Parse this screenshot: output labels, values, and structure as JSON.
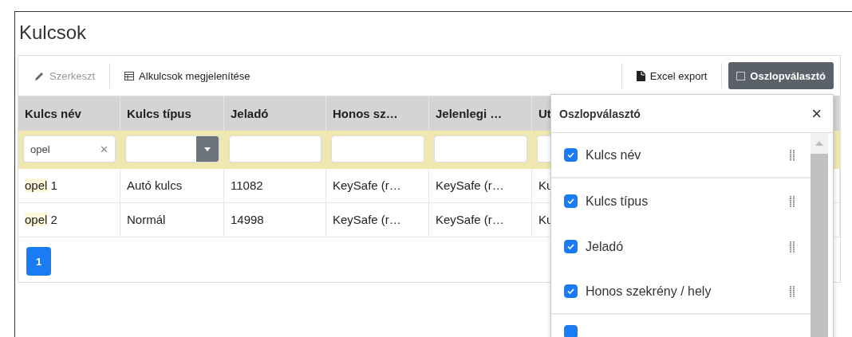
{
  "title": "Kulcsok",
  "toolbar": {
    "left": [
      {
        "label": "Szerkeszt",
        "disabled": true
      },
      {
        "label": "Alkulcsok megjelenítése",
        "disabled": false
      }
    ],
    "right": [
      {
        "label": "Excel export",
        "selected": false
      },
      {
        "label": "Oszlopválasztó",
        "selected": true
      }
    ]
  },
  "table": {
    "columns": [
      "Kulcs név",
      "Kulcs típus",
      "Jeladó",
      "Honos sz…",
      "Jelenlegi …",
      "Ut"
    ],
    "filters": [
      {
        "kind": "text",
        "value": "opel",
        "clear": "✕"
      },
      {
        "kind": "select"
      },
      {
        "kind": "text"
      },
      {
        "kind": "text"
      },
      {
        "kind": "text"
      },
      {
        "kind": "text"
      }
    ],
    "rows": [
      [
        {
          "highlighted": "opel",
          "text": " 1"
        },
        {
          "text": "Autó kulcs"
        },
        {
          "text": "11082"
        },
        {
          "text": "KeySafe (r…"
        },
        {
          "text": "KeySafe (r…"
        },
        {
          "text": "Ku"
        }
      ],
      [
        {
          "highlighted": "opel",
          "text": " 2"
        },
        {
          "text": "Normál"
        },
        {
          "text": "14998"
        },
        {
          "text": "KeySafe (r…"
        },
        {
          "text": "KeySafe (r…"
        },
        {
          "text": "Ku"
        }
      ]
    ]
  },
  "pager": [
    {
      "label": "1",
      "selected": true
    }
  ],
  "column_chooser": {
    "title": "Oszlopválasztó",
    "close": "×",
    "items": [
      {
        "label": "Kulcs név",
        "checked": true,
        "divider": true
      },
      {
        "label": "Kulcs típus",
        "checked": true,
        "divider": false
      },
      {
        "label": "Jeladó",
        "checked": true,
        "divider": false
      },
      {
        "label": "Honos szekrény / hely",
        "checked": true,
        "divider": true
      }
    ],
    "partial_item": {
      "checked": true
    }
  }
}
